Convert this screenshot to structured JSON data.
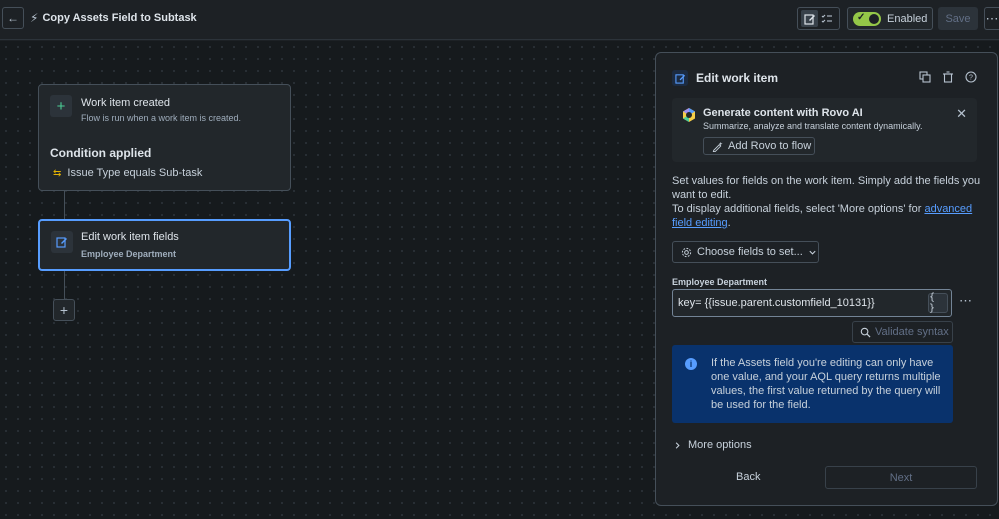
{
  "topbar": {
    "title": "Copy Assets Field to Subtask",
    "enabled_label": "Enabled",
    "save_label": "Save"
  },
  "flow": {
    "trigger_title": "Work item created",
    "trigger_sub": "Flow is run when a work item is created.",
    "condition_title": "Condition applied",
    "condition_text": "Issue Type equals Sub-task",
    "action_title": "Edit work item fields",
    "action_sub": "Employee Department"
  },
  "panel": {
    "title": "Edit work item",
    "rovo": {
      "title": "Generate content with Rovo AI",
      "subtitle": "Summarize, analyze and translate content dynamically.",
      "button": "Add Rovo to flow"
    },
    "desc_line1": "Set values for fields on the work item. Simply add the fields you want to edit.",
    "desc_line2_prefix": "To display additional fields, select 'More options' for ",
    "desc_link": "advanced field editing",
    "desc_suffix": ".",
    "choose_fields": "Choose fields to set...",
    "field_label": "Employee Department",
    "field_value": "key= {{issue.parent.customfield_10131}}",
    "braces": "{ }",
    "validate": "Validate syntax",
    "info_text": "If the Assets field you're editing can only have one value, and your AQL query returns multiple values, the first value returned by the query will be used for the field.",
    "more_options": "More options",
    "back": "Back",
    "next": "Next"
  },
  "colors": {
    "accent": "#579dff",
    "enabled": "#94c748",
    "info_bg": "#09326c"
  }
}
